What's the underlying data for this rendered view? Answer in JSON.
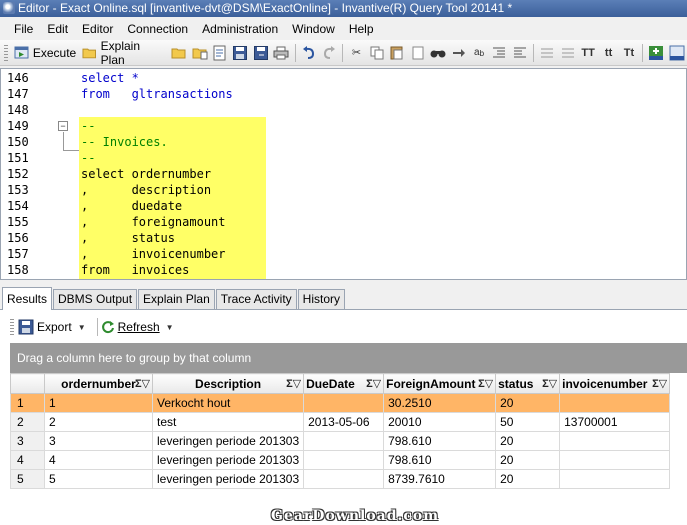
{
  "window": {
    "title": "Editor - Exact Online.sql [invantive-dvt@DSM\\ExactOnline] - Invantive(R) Query Tool 20141 *"
  },
  "menu": [
    "File",
    "Edit",
    "Editor",
    "Connection",
    "Administration",
    "Window",
    "Help"
  ],
  "toolbar": {
    "execute_label": "Execute",
    "explain_plan_label": "Explain Plan"
  },
  "editor": {
    "lines": [
      {
        "num": "146",
        "code": "select *"
      },
      {
        "num": "147",
        "code": "from   gltransactions"
      },
      {
        "num": "148",
        "code": ""
      },
      {
        "num": "149",
        "code": "--"
      },
      {
        "num": "150",
        "code": "-- Invoices."
      },
      {
        "num": "151",
        "code": "--"
      },
      {
        "num": "152",
        "code": "select ordernumber"
      },
      {
        "num": "153",
        "code": ",      description"
      },
      {
        "num": "154",
        "code": ",      duedate"
      },
      {
        "num": "155",
        "code": ",      foreignamount"
      },
      {
        "num": "156",
        "code": ",      status"
      },
      {
        "num": "157",
        "code": ",      invoicenumber"
      },
      {
        "num": "158",
        "code": "from   invoices"
      }
    ]
  },
  "tabs": [
    "Results",
    "DBMS Output",
    "Explain Plan",
    "Trace Activity",
    "History"
  ],
  "results": {
    "export_label": "Export",
    "refresh_label": "Refresh",
    "group_hint": "Drag a column here to group by that column",
    "columns": [
      "ordernumber",
      "Description",
      "DueDate",
      "ForeignAmount",
      "status",
      "invoicenumber"
    ],
    "rows": [
      {
        "rn": "1",
        "cells": [
          "1",
          "Verkocht hout",
          "",
          "30.2510",
          "20",
          ""
        ]
      },
      {
        "rn": "2",
        "cells": [
          "2",
          "test",
          "2013-05-06",
          "20010",
          "50",
          "13700001"
        ]
      },
      {
        "rn": "3",
        "cells": [
          "3",
          "leveringen periode 201303",
          "",
          "798.610",
          "20",
          ""
        ]
      },
      {
        "rn": "4",
        "cells": [
          "4",
          "leveringen periode 201303",
          "",
          "798.610",
          "20",
          ""
        ]
      },
      {
        "rn": "5",
        "cells": [
          "5",
          "leveringen periode 201303",
          "",
          "8739.7610",
          "20",
          ""
        ]
      }
    ]
  },
  "watermark": "GearDownload.com",
  "colors": {
    "highlight": "#ffff66",
    "selected_row": "#ffb566",
    "keyword": "#0000cc",
    "comment": "#008000"
  }
}
